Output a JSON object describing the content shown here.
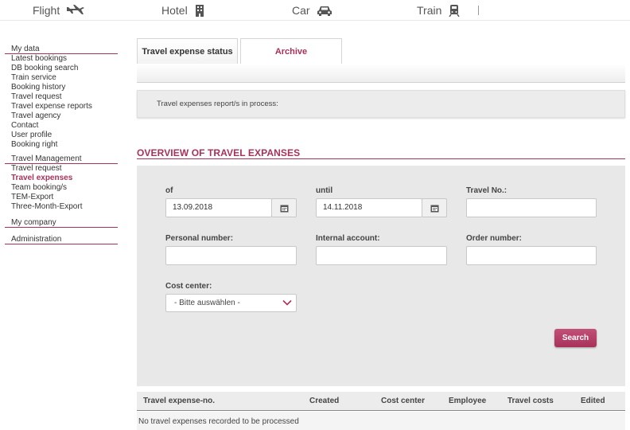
{
  "topnav": {
    "items": [
      {
        "label": "Flight",
        "icon": "airplane-icon"
      },
      {
        "label": "Hotel",
        "icon": "building-icon"
      },
      {
        "label": "Car",
        "icon": "car-icon"
      },
      {
        "label": "Train",
        "icon": "train-icon"
      }
    ]
  },
  "sidebar": {
    "sections": [
      {
        "heading": "My data",
        "items": [
          "Latest bookings",
          "DB booking search",
          "Train service",
          "Booking history",
          "Travel request",
          "Travel expense reports",
          "Travel agency",
          "Contact",
          "User profile",
          "Booking right"
        ]
      },
      {
        "heading": "Travel Management",
        "items": [
          "Travel request",
          "Travel expenses",
          "Team booking/s",
          "TEM-Export",
          "Three-Month-Export"
        ],
        "active_index": 1
      },
      {
        "heading": "My company",
        "items": []
      },
      {
        "heading": "Administration",
        "items": []
      }
    ]
  },
  "tabs": {
    "status": "Travel expense status",
    "archive": "Archive"
  },
  "status_message": "Travel expenses report/s in process:",
  "overview": {
    "title": "OVERVIEW OF TRAVEL EXPANSES",
    "fields": {
      "of_label": "of",
      "of_value": "13.09.2018",
      "until_label": "until",
      "until_value": "14.11.2018",
      "travel_no_label": "Travel No.:",
      "travel_no_value": "",
      "personal_number_label": "Personal number:",
      "personal_number_value": "",
      "internal_account_label": "Internal account:",
      "internal_account_value": "",
      "order_number_label": "Order number:",
      "order_number_value": "",
      "cost_center_label": "Cost center:",
      "cost_center_selected": "- Bitte auswählen -"
    },
    "search_label": "Search"
  },
  "table": {
    "columns": [
      "Travel expense-no.",
      "Created",
      "Cost center",
      "Employee",
      "Travel costs",
      "Edited"
    ],
    "empty_message": "No travel expenses recorded to be processed"
  },
  "colors": {
    "accent": "#a8315a",
    "panel": "#e8e8e8"
  }
}
